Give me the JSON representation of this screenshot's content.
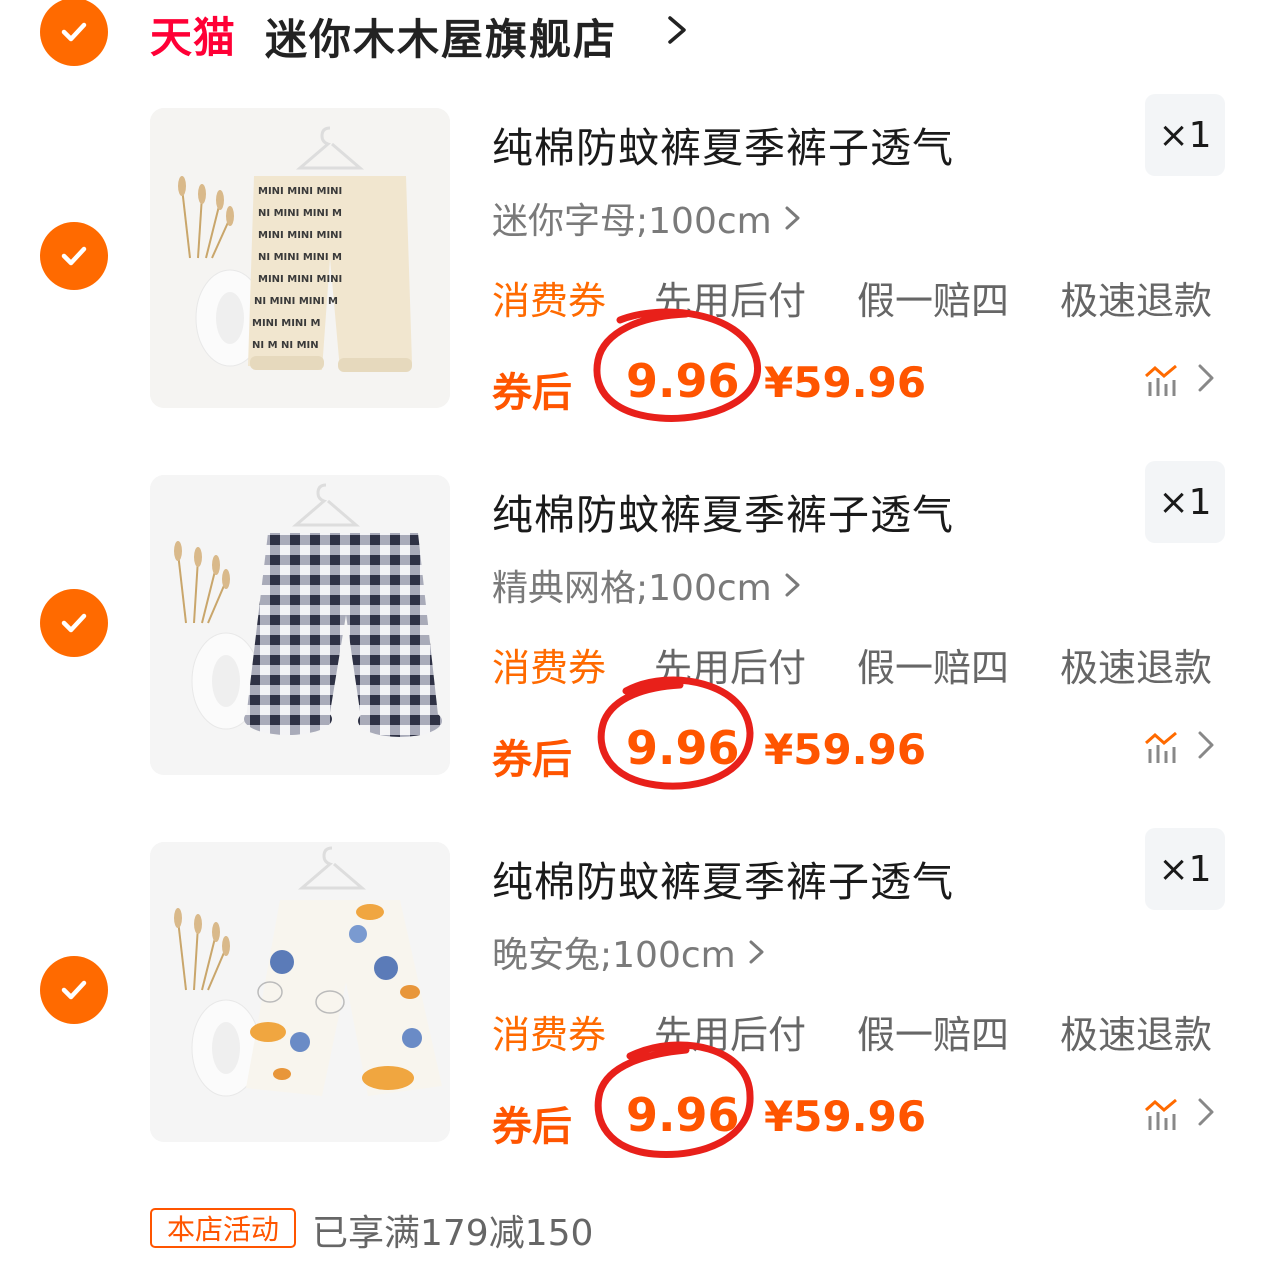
{
  "store": {
    "platform": "天猫",
    "name": "迷你木木屋旗舰店",
    "accent_color": "#ff6a00",
    "platform_color": "#ff0036"
  },
  "items": [
    {
      "title": "纯棉防蚊裤夏季裤子透气",
      "quantity": "×1",
      "sku": "迷你字母;100cm",
      "tags": [
        "消费券",
        "先用后付",
        "假一赔四",
        "极速退款"
      ],
      "price_label": "券后",
      "final_price": "9.96",
      "original_price": "¥59.96",
      "pattern": "letters"
    },
    {
      "title": "纯棉防蚊裤夏季裤子透气",
      "quantity": "×1",
      "sku": "精典网格;100cm",
      "tags": [
        "消费券",
        "先用后付",
        "假一赔四",
        "极速退款"
      ],
      "price_label": "券后",
      "final_price": "9.96",
      "original_price": "¥59.96",
      "pattern": "gingham"
    },
    {
      "title": "纯棉防蚊裤夏季裤子透气",
      "quantity": "×1",
      "sku": "晚安兔;100cm",
      "tags": [
        "消费券",
        "先用后付",
        "假一赔四",
        "极速退款"
      ],
      "price_label": "券后",
      "final_price": "9.96",
      "original_price": "¥59.96",
      "pattern": "bunny"
    }
  ],
  "promotion": {
    "badge": "本店活动",
    "text": "已享满179减150"
  }
}
